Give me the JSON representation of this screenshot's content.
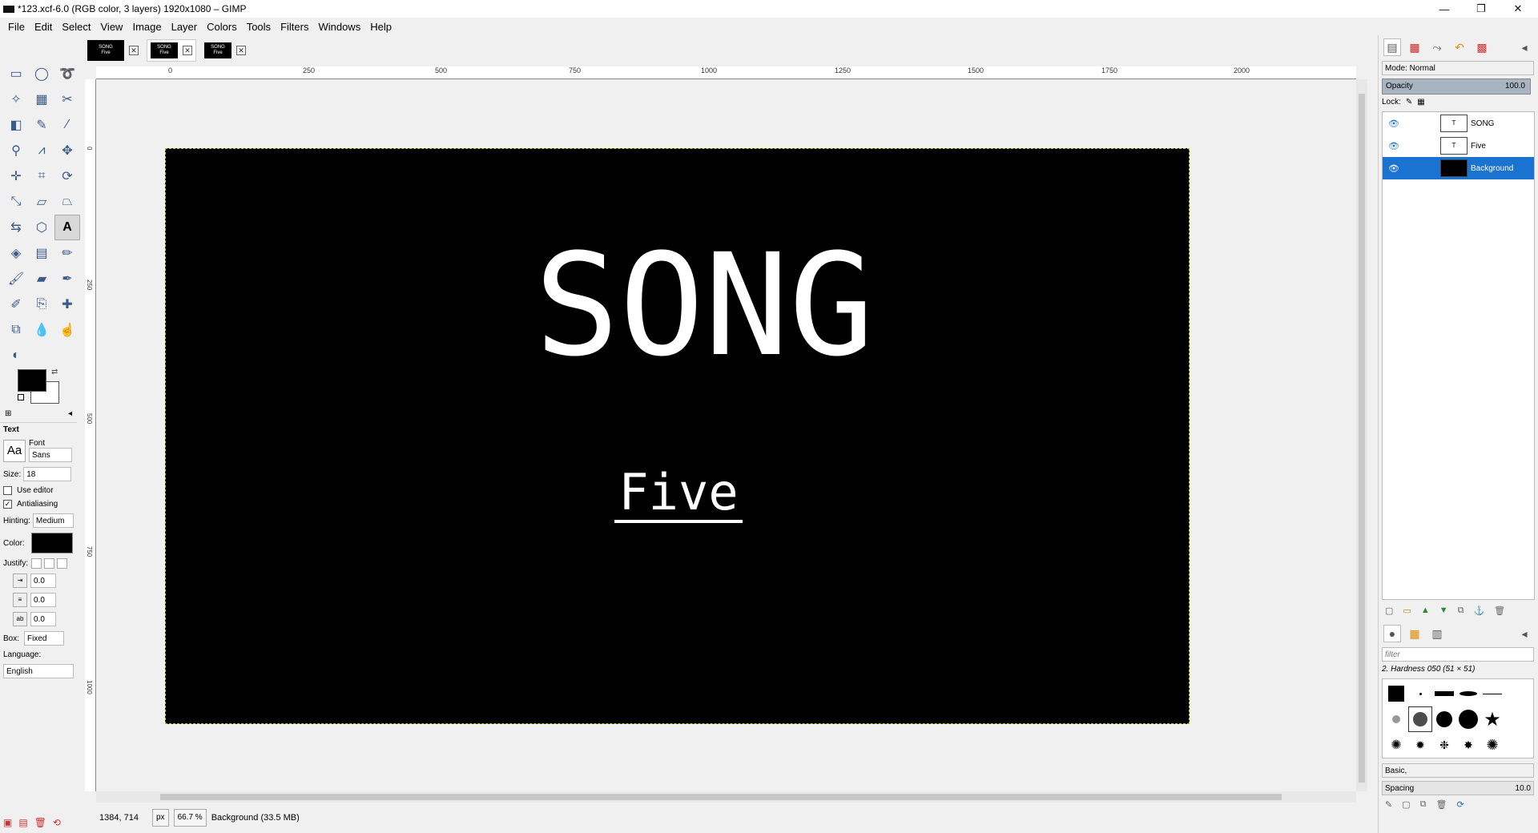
{
  "window": {
    "title": "*123.xcf-6.0 (RGB color, 3 layers) 1920x1080 – GIMP",
    "minimize": "—",
    "maximize": "❐",
    "close": "✕"
  },
  "menu": [
    "File",
    "Edit",
    "Select",
    "View",
    "Image",
    "Layer",
    "Colors",
    "Tools",
    "Filters",
    "Windows",
    "Help"
  ],
  "image_tabs": [
    {
      "thumb_line1": "SONG",
      "thumb_line2": "Five",
      "close": "✕"
    },
    {
      "thumb_line1": "SONG",
      "thumb_line2": "Five",
      "close": "✕"
    },
    {
      "thumb_line1": "SONG",
      "thumb_line2": "Five",
      "close": "✕"
    }
  ],
  "ruler": {
    "top_ticks": [
      "0",
      "250",
      "500",
      "750",
      "1000",
      "1250",
      "1500",
      "1750",
      "2000"
    ],
    "left_ticks": [
      "0",
      "250",
      "500",
      "750",
      "1000"
    ]
  },
  "canvas": {
    "title_text": "SONG",
    "subtitle_text": "Five"
  },
  "tool_options": {
    "title": "Text",
    "font_label": "Font",
    "font_preview": "Aa",
    "font_value": "Sans",
    "size_label": "Size:",
    "size_value": "18",
    "use_editor_label": "Use editor",
    "antialiasing_label": "Antialiasing",
    "antialiasing_checked": "✓",
    "hinting_label": "Hinting:",
    "hinting_value": "Medium",
    "color_label": "Color:",
    "justify_label": "Justify:",
    "indent_value": "0.0",
    "line_spacing_value": "0.0",
    "letter_spacing_value": "0.0",
    "box_label": "Box:",
    "box_value": "Fixed",
    "language_label": "Language:",
    "language_value": "English"
  },
  "status": {
    "coords": "1384, 714",
    "unit": "px",
    "zoom": "66.7 %",
    "message": "Background (33.5 MB)"
  },
  "layers": {
    "mode_label": "Mode: Normal",
    "opacity_label": "Opacity",
    "opacity_value": "100.0",
    "lock_label": "Lock:",
    "items": [
      {
        "name": "SONG"
      },
      {
        "name": "Five"
      },
      {
        "name": "Background"
      }
    ]
  },
  "brushes": {
    "filter_placeholder": "filter",
    "current_brush": "2. Hardness 050 (51 × 51)",
    "preset": "Basic,",
    "spacing_label": "Spacing",
    "spacing_value": "10.0"
  },
  "colors": {
    "selection": "#1a73d1",
    "foreground": "#000000",
    "background": "#ffffff"
  }
}
